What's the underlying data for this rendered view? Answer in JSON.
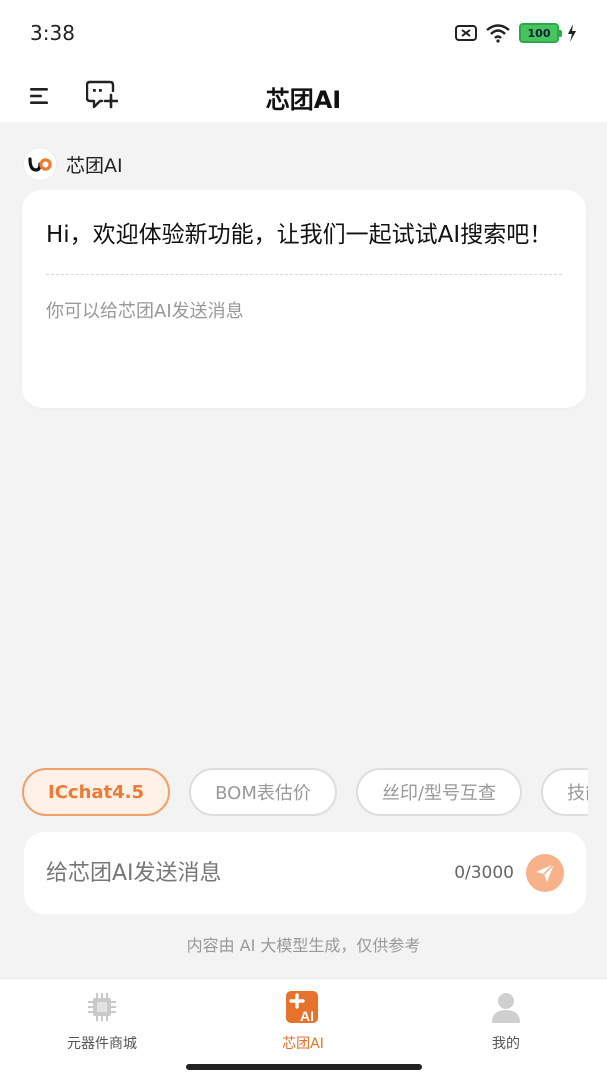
{
  "status_bar": {
    "time": "3:38",
    "battery": "100"
  },
  "header": {
    "title": "芯团AI"
  },
  "assistant": {
    "name": "芯团AI"
  },
  "message": {
    "text": "Hi，欢迎体验新功能，让我们一起试试AI搜索吧！",
    "hint": "你可以给芯团AI发送消息"
  },
  "chips": [
    {
      "label": "ICchat4.5",
      "active": true
    },
    {
      "label": "BOM表估价",
      "active": false
    },
    {
      "label": "丝印/型号互查",
      "active": false
    },
    {
      "label": "技能",
      "active": false
    }
  ],
  "input": {
    "placeholder": "给芯团AI发送消息",
    "counter": "0/3000"
  },
  "disclaimer": "内容由 AI 大模型生成，仅供参考",
  "bottom_nav": [
    {
      "label": "元器件商城",
      "icon": "chip-icon",
      "active": false
    },
    {
      "label": "芯团AI",
      "icon": "ai-plus-icon",
      "active": true
    },
    {
      "label": "我的",
      "icon": "user-icon",
      "active": false
    }
  ],
  "colors": {
    "accent": "#ee7a34",
    "background": "#f3f3f3"
  }
}
